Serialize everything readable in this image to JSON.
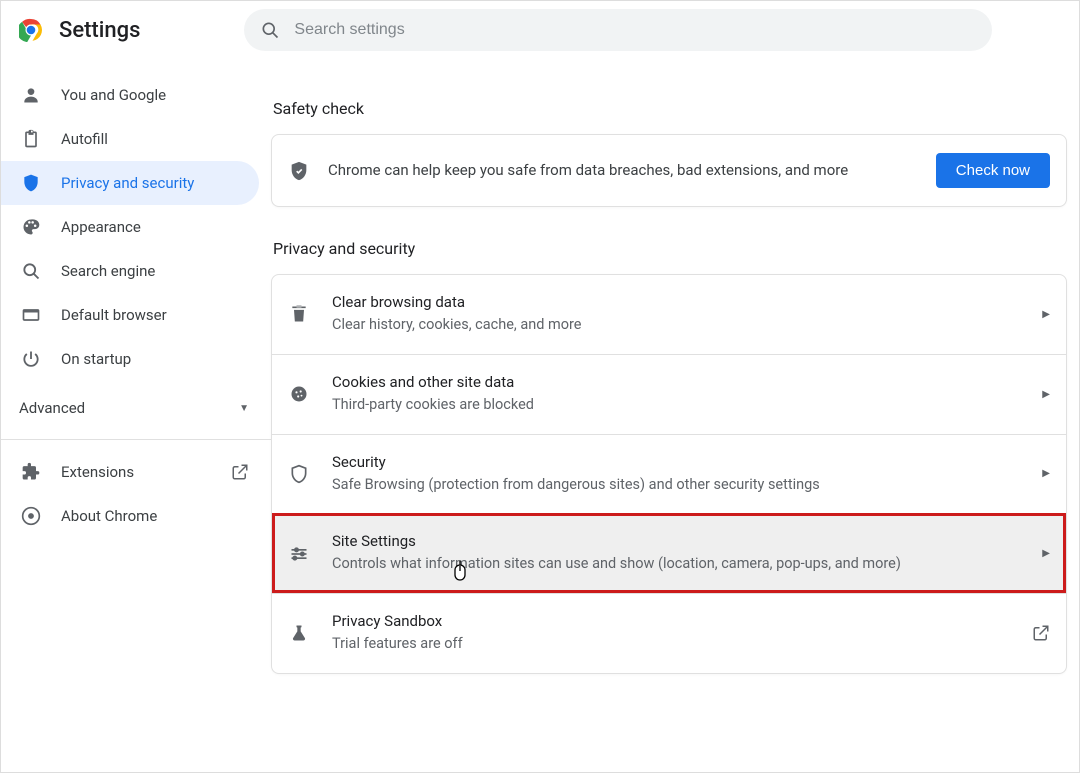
{
  "header": {
    "title": "Settings",
    "search_placeholder": "Search settings"
  },
  "sidebar": {
    "items": [
      {
        "icon": "person",
        "label": "You and Google"
      },
      {
        "icon": "clipboard",
        "label": "Autofill"
      },
      {
        "icon": "shield",
        "label": "Privacy and security",
        "active": true
      },
      {
        "icon": "palette",
        "label": "Appearance"
      },
      {
        "icon": "search",
        "label": "Search engine"
      },
      {
        "icon": "browser",
        "label": "Default browser"
      },
      {
        "icon": "power",
        "label": "On startup"
      }
    ],
    "advanced_label": "Advanced",
    "extensions_label": "Extensions",
    "about_label": "About Chrome"
  },
  "main": {
    "safety": {
      "heading": "Safety check",
      "text": "Chrome can help keep you safe from data breaches, bad extensions, and more",
      "button": "Check now"
    },
    "privacy": {
      "heading": "Privacy and security",
      "items": [
        {
          "title": "Clear browsing data",
          "sub": "Clear history, cookies, cache, and more"
        },
        {
          "title": "Cookies and other site data",
          "sub": "Third-party cookies are blocked"
        },
        {
          "title": "Security",
          "sub": "Safe Browsing (protection from dangerous sites) and other security settings"
        },
        {
          "title": "Site Settings",
          "sub": "Controls what information sites can use and show (location, camera, pop-ups, and more)"
        },
        {
          "title": "Privacy Sandbox",
          "sub": "Trial features are off"
        }
      ]
    }
  }
}
